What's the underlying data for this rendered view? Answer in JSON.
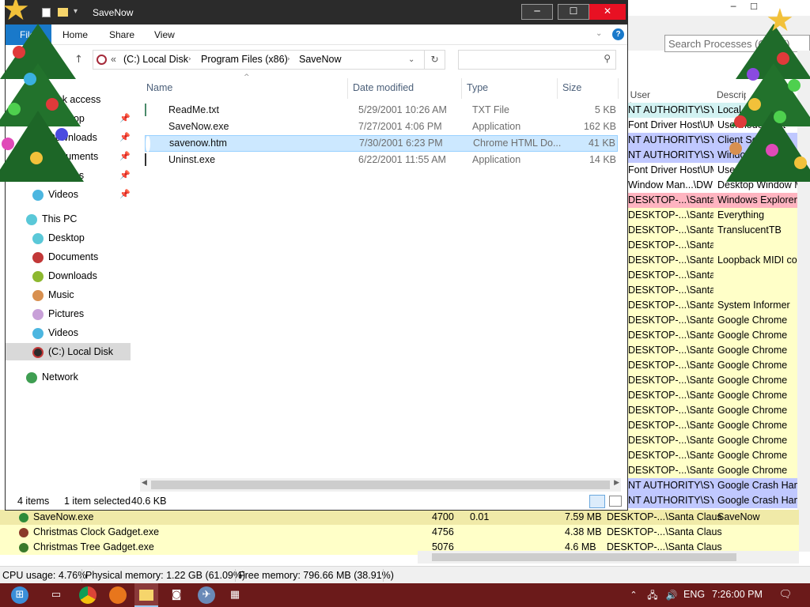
{
  "process_explorer": {
    "search_placeholder": "Search Processes (Ctrl+F)",
    "col_user": "User Name",
    "col_desc": "Description",
    "rows": [
      {
        "user": "NT AUTHORITY\\SYSTEM",
        "desc": "Local Security",
        "color": "#d2f2f2"
      },
      {
        "user": "Font Driver Host\\UMFD-",
        "desc": "Usermode Font",
        "color": "#ffffff"
      },
      {
        "user": "NT AUTHORITY\\SYSTEM",
        "desc": "Client Server",
        "color": "#c0c8ff"
      },
      {
        "user": "NT AUTHORITY\\SYSTEM",
        "desc": "Windows Logon",
        "color": "#c0c8ff"
      },
      {
        "user": "Font Driver Host\\UMFD-",
        "desc": "Usermode Font",
        "color": "#ffffff"
      },
      {
        "user": "Window Man...\\DWM-1",
        "desc": "Desktop Window Manager",
        "color": "#ffffff"
      },
      {
        "user": "DESKTOP-...\\Santa Claus",
        "desc": "Windows Explorer",
        "color": "#ffb4c0"
      },
      {
        "user": "DESKTOP-...\\Santa Claus",
        "desc": "Everything",
        "color": "#ffffc8"
      },
      {
        "user": "DESKTOP-...\\Santa Claus",
        "desc": "TranslucentTB",
        "color": "#ffffc8"
      },
      {
        "user": "DESKTOP-...\\Santa Claus",
        "desc": "",
        "color": "#ffffc8"
      },
      {
        "user": "DESKTOP-...\\Santa Claus",
        "desc": "Loopback MIDI control",
        "color": "#ffffc8"
      },
      {
        "user": "DESKTOP-...\\Santa Claus",
        "desc": "",
        "color": "#ffffc8"
      },
      {
        "user": "DESKTOP-...\\Santa Claus",
        "desc": "",
        "color": "#ffffc8"
      },
      {
        "user": "DESKTOP-...\\Santa Claus",
        "desc": "System Informer",
        "color": "#ffffc8"
      },
      {
        "user": "DESKTOP-...\\Santa Claus",
        "desc": "Google Chrome",
        "color": "#ffffc8"
      },
      {
        "user": "DESKTOP-...\\Santa Claus",
        "desc": "Google Chrome",
        "color": "#ffffc8"
      },
      {
        "user": "DESKTOP-...\\Santa Claus",
        "desc": "Google Chrome",
        "color": "#ffffc8"
      },
      {
        "user": "DESKTOP-...\\Santa Claus",
        "desc": "Google Chrome",
        "color": "#ffffc8"
      },
      {
        "user": "DESKTOP-...\\Santa Claus",
        "desc": "Google Chrome",
        "color": "#ffffc8"
      },
      {
        "user": "DESKTOP-...\\Santa Claus",
        "desc": "Google Chrome",
        "color": "#ffffc8"
      },
      {
        "user": "DESKTOP-...\\Santa Claus",
        "desc": "Google Chrome",
        "color": "#ffffc8"
      },
      {
        "user": "DESKTOP-...\\Santa Claus",
        "desc": "Google Chrome",
        "color": "#ffffc8"
      },
      {
        "user": "DESKTOP-...\\Santa Claus",
        "desc": "Google Chrome",
        "color": "#ffffc8"
      },
      {
        "user": "DESKTOP-...\\Santa Claus",
        "desc": "Google Chrome",
        "color": "#ffffc8"
      },
      {
        "user": "DESKTOP-...\\Santa Claus",
        "desc": "Google Chrome",
        "color": "#ffffc8"
      },
      {
        "user": "NT AUTHORITY\\SYSTEM",
        "desc": "Google Crash Handler",
        "color": "#c0c8ff"
      },
      {
        "user": "NT AUTHORITY\\SYSTEM",
        "desc": "Google Crash Handler",
        "color": "#c0c8ff"
      }
    ],
    "bottom_rows": [
      {
        "name": "SaveNow.exe",
        "pid": "4700",
        "cpu": "0.01",
        "mem": "7.59 MB",
        "user": "DESKTOP-...\\Santa Claus",
        "desc": "SaveNow",
        "highlight": true
      },
      {
        "name": "Christmas Clock Gadget.exe",
        "pid": "4756",
        "cpu": "",
        "mem": "4.38 MB",
        "user": "DESKTOP-...\\Santa Claus",
        "desc": "",
        "highlight": false
      },
      {
        "name": "Christmas Tree Gadget.exe",
        "pid": "5076",
        "cpu": "",
        "mem": "4.6 MB",
        "user": "DESKTOP-...\\Santa Claus",
        "desc": "",
        "highlight": false
      }
    ],
    "status": {
      "cpu": "CPU usage: 4.76%",
      "physical": "Physical memory: 1.22 GB (61.09%)",
      "free": "Free memory: 796.66 MB (38.91%)"
    }
  },
  "explorer": {
    "title": "SaveNow",
    "ribbon": {
      "file": "File",
      "home": "Home",
      "share": "Share",
      "view": "View"
    },
    "address": {
      "prefix": "«",
      "part1": "(C:) Local Disk",
      "part2": "Program Files (x86)",
      "part3": "SaveNow"
    },
    "nav": {
      "quick_access": "Quick access",
      "desktop_qa": "Desktop",
      "downloads_qa": "Downloads",
      "documents_qa": "Documents",
      "pictures_qa": "Pictures",
      "videos_qa": "Videos",
      "this_pc": "This PC",
      "desktop": "Desktop",
      "documents": "Documents",
      "downloads": "Downloads",
      "music": "Music",
      "pictures": "Pictures",
      "videos": "Videos",
      "local_disk": "(C:) Local Disk",
      "network": "Network"
    },
    "columns": {
      "name": "Name",
      "date": "Date modified",
      "type": "Type",
      "size": "Size"
    },
    "files": [
      {
        "name": "ReadMe.txt",
        "date": "5/29/2001 10:26 AM",
        "type": "TXT File",
        "size": "5 KB"
      },
      {
        "name": "SaveNow.exe",
        "date": "7/27/2001 4:06 PM",
        "type": "Application",
        "size": "162 KB"
      },
      {
        "name": "savenow.htm",
        "date": "7/30/2001 6:23 PM",
        "type": "Chrome HTML Do...",
        "size": "41 KB"
      },
      {
        "name": "Uninst.exe",
        "date": "6/22/2001 11:55 AM",
        "type": "Application",
        "size": "14 KB"
      }
    ],
    "status": {
      "count": "4 items",
      "selected": "1 item selected",
      "size": "40.6 KB"
    }
  },
  "taskbar": {
    "lang": "ENG",
    "time": "7:26:00 PM"
  },
  "colors": {
    "accent": "#1979ca",
    "selection": "#cce8ff",
    "close": "#e81123",
    "taskbar": "#6b1a1a"
  }
}
